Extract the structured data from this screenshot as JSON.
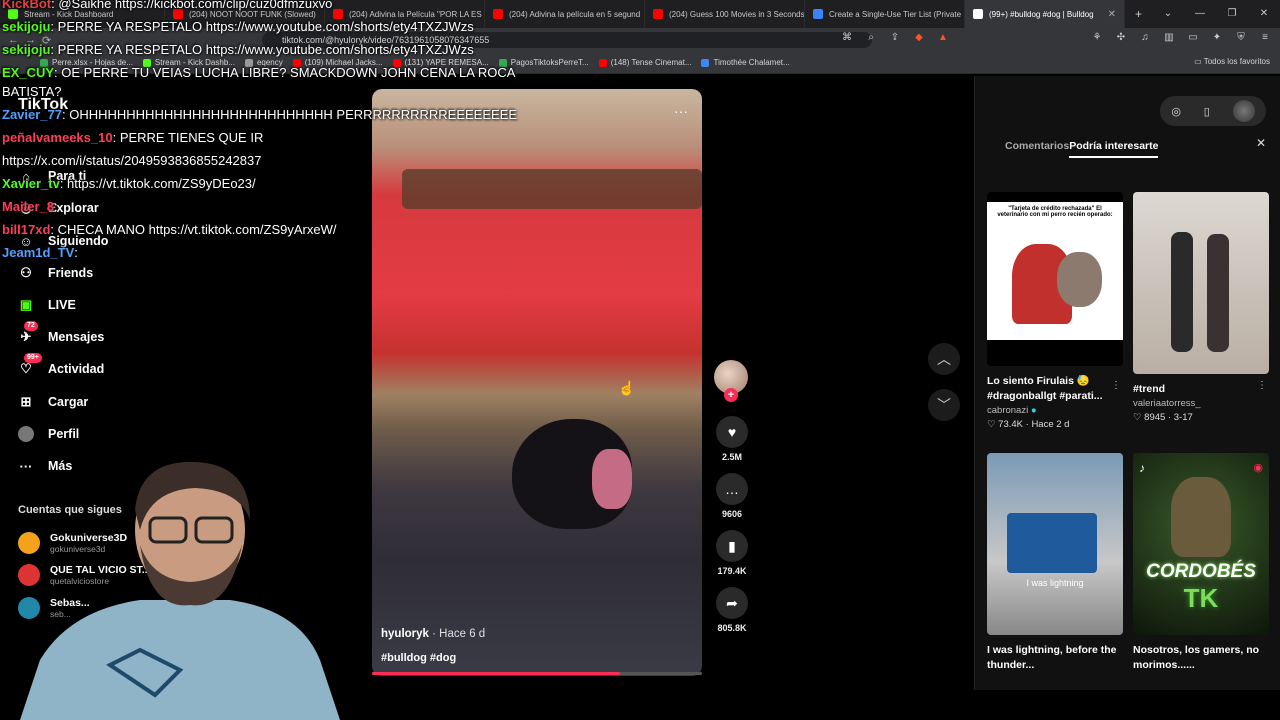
{
  "browser": {
    "tabs": [
      {
        "label": "Stream - Kick Dashboard",
        "color": "#53fc18"
      },
      {
        "label": "(204) NOOT NOOT FUNK (Slowed)",
        "color": "#ff0000"
      },
      {
        "label": "(204) Adivina la Película \"POR LA ES",
        "color": "#ff0000"
      },
      {
        "label": "(204) Adivina la película en 5 segund",
        "color": "#ff0000"
      },
      {
        "label": "(204) Guess 100 Movies in 3 Seconds",
        "color": "#ff0000"
      },
      {
        "label": "Create a Single-Use Tier List (Private",
        "color": "#3b82f6"
      },
      {
        "label": "(99+) #bulldog #dog | Bulldog",
        "color": "#ffffff"
      }
    ],
    "url": "tiktok.com/@hyuloryk/video/7631961058076347655",
    "bookmarks": [
      {
        "label": "Perre.xlsx - Hojas de...",
        "color": "#34a853"
      },
      {
        "label": "Stream - Kick Dashb...",
        "color": "#53fc18"
      },
      {
        "label": "eqency",
        "color": "#999999"
      },
      {
        "label": "(109) Michael Jacks...",
        "color": "#ff0000"
      },
      {
        "label": "(131) YAPE REMESA...",
        "color": "#ff0000"
      },
      {
        "label": "PagosTiktoksPerreT...",
        "color": "#34a853"
      },
      {
        "label": "(148) Tense Cinemat...",
        "color": "#ff0000"
      },
      {
        "label": "Timothée Chalamet...",
        "color": "#4285f4"
      }
    ],
    "bookmarks_all": "Todos los favoritos"
  },
  "chat": [
    {
      "user": "KickBot",
      "color": "#e34141",
      "text": ": @Saikhe https://kickbot.com/clip/cuz0dfmzuxvo"
    },
    {
      "user": "sekijoju",
      "color": "#53fc18",
      "text": ": PERRE YA RESPETALO https://www.youtube.com/shorts/ety4TXZJWzs"
    },
    {
      "user": "sekijoju",
      "color": "#53fc18",
      "text": ": PERRE YA RESPETALO https://www.youtube.com/shorts/ety4TXZJWzs"
    },
    {
      "user": "EX_CUY",
      "color": "#53fc18",
      "text": ": OE PERRE TU VEIAS LUCHA LIBRE? SMACKDOWN JOHN CENA LA ROCA"
    },
    {
      "user": "",
      "color": "#ffffff",
      "text": "BATISTA?"
    },
    {
      "user": "Zavier_77",
      "color": "#53a0fc",
      "text": ": OHHHHHHHHHHHHHHHHHHHHHHHHHHH PERRRRRRRRRREEEEEEEE"
    },
    {
      "user": "peñalvameeks_10",
      "color": "#ff3d5a",
      "text": ": PERRE TIENES QUE IR"
    },
    {
      "user": "",
      "color": "#ffffff",
      "text": "https://x.com/i/status/2049593836855242837"
    },
    {
      "user": "Xavier_tv",
      "color": "#53fc18",
      "text": ": https://vt.tiktok.com/ZS9yDEo23/"
    },
    {
      "user": "Mailer_8",
      "color": "#ff3d5a",
      "text": ":"
    },
    {
      "user": "bill17xd",
      "color": "#ff3d5a",
      "text": ": CHECA MANO https://vt.tiktok.com/ZS9yArxeW/"
    },
    {
      "user": "Jeam1d_TV",
      "color": "#53a0fc",
      "text": ":"
    }
  ],
  "tiktok": {
    "logo": "TikTok",
    "nav": [
      {
        "label": "Para ti",
        "icon": "home-icon"
      },
      {
        "label": "Explorar",
        "icon": "compass-icon"
      },
      {
        "label": "Siguiendo",
        "icon": "following-icon"
      },
      {
        "label": "Friends",
        "icon": "friends-icon"
      },
      {
        "label": "LIVE",
        "icon": "live-icon"
      },
      {
        "label": "Mensajes",
        "icon": "message-icon",
        "badge": "72"
      },
      {
        "label": "Actividad",
        "icon": "activity-icon",
        "badge": "99+"
      },
      {
        "label": "Cargar",
        "icon": "upload-icon"
      },
      {
        "label": "Perfil",
        "icon": "profile-icon"
      },
      {
        "label": "Más",
        "icon": "more-icon"
      }
    ],
    "following_title": "Cuentas que sigues",
    "following": [
      {
        "name": "Gokuniverse3D",
        "handle": "gokuniverse3d",
        "color": "#f4a21c"
      },
      {
        "name": "QUE TAL VICIO ST...",
        "handle": "quetalviciostore",
        "color": "#d33"
      },
      {
        "name": "Sebas...",
        "handle": "seb...",
        "color": "#28a"
      }
    ]
  },
  "video": {
    "author": "hyuloryk",
    "time": " · Hace 6 d",
    "tags": "#bulldog #dog",
    "progress": 0.75,
    "likes": "2.5M",
    "comments": "9606",
    "saves": "179.4K",
    "shares": "805.8K"
  },
  "panel": {
    "tab_comments": "Comentarios",
    "tab_interest": "Podría interesarte",
    "cards": [
      {
        "caption": "Lo siento Firulais 😓 #dragonballgt #parati...",
        "author": "cabronazi",
        "likes": "73.4K",
        "time": " · Hace 2 d",
        "thumb_text": "\"Tarjeta de crédito rechazada\" El veterinario con mi perro recién operado:"
      },
      {
        "caption": "#trend",
        "author": "valeriaatorress_",
        "likes": "8945",
        "time": " · 3-17"
      },
      {
        "caption": "I was lightning, before the thunder...",
        "thumb_label": "I was lightning"
      },
      {
        "caption": "Nosotros, los gamers, no morimos......",
        "thumb_big": "CORDOBÉS",
        "thumb_big2": "TK"
      }
    ]
  }
}
